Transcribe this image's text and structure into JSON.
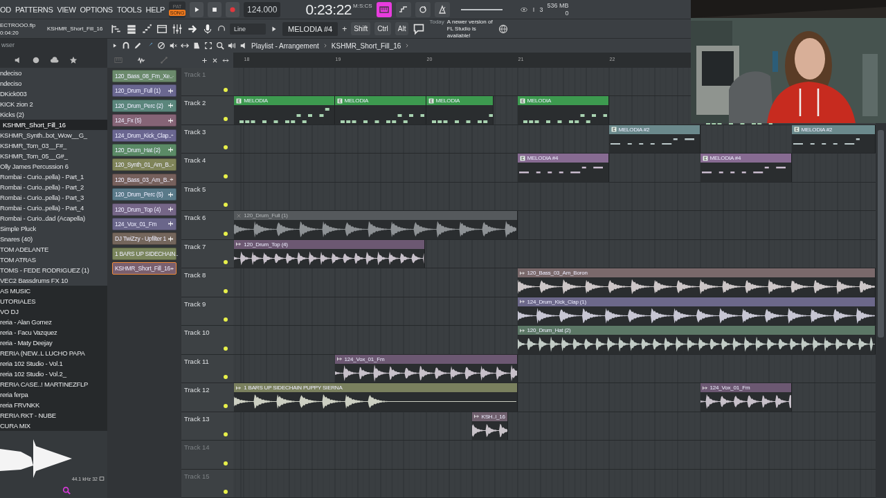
{
  "menu": [
    "OD",
    "PATTERNS",
    "VIEW",
    "OPTIONS",
    "TOOLS",
    "HELP"
  ],
  "modes": [
    {
      "label": "PAT",
      "selected": false
    },
    {
      "label": "SONG",
      "selected": true
    }
  ],
  "tempo": "124.000",
  "time": {
    "value": "0:23:22",
    "unit": "M:S:CS"
  },
  "monitor": {
    "cpu": "3",
    "memory": "536 MB",
    "polyphony": "0"
  },
  "project": {
    "file": "ECTROOO.flp",
    "duration": "0:04:20",
    "sample": "KSHMR_Short_Fill_16"
  },
  "recording_input": "Line",
  "pattern": {
    "name": "MELODIA #4",
    "add": "+"
  },
  "modifiers": [
    "Shift",
    "Ctrl",
    "Alt"
  ],
  "hint": {
    "date": "Today",
    "message": "A newer version of FL Studio is available!"
  },
  "browser": {
    "title": "wser",
    "items": [
      {
        "label": "ndeciso",
        "kind": "file",
        "selected": false
      },
      {
        "label": "ndeciso",
        "kind": "file",
        "selected": false
      },
      {
        "label": "DKick003",
        "kind": "file",
        "selected": false
      },
      {
        "label": "KICK zion 2",
        "kind": "file",
        "selected": false
      },
      {
        "label": "Kicks (2)",
        "kind": "file",
        "selected": false
      },
      {
        "label": "KSHMR_Short_Fill_16",
        "kind": "file",
        "selected": true
      },
      {
        "label": "KSHMR_Synth..bot_Wow__G_",
        "kind": "file",
        "selected": false
      },
      {
        "label": "KSHMR_Tom_03__F#_",
        "kind": "file",
        "selected": false
      },
      {
        "label": "KSHMR_Tom_05__G#_",
        "kind": "file",
        "selected": false
      },
      {
        "label": "Olly James Percussion 6",
        "kind": "file",
        "selected": false
      },
      {
        "label": "Rombai - Curio..pella) - Part_1",
        "kind": "file",
        "selected": false
      },
      {
        "label": "Rombai - Curio..pella) - Part_2",
        "kind": "file",
        "selected": false
      },
      {
        "label": "Rombai - Curio..pella) - Part_3",
        "kind": "file",
        "selected": false
      },
      {
        "label": "Rombai - Curio..pella) - Part_4",
        "kind": "file",
        "selected": false
      },
      {
        "label": "Rombai - Curio..dad (Acapella)",
        "kind": "file",
        "selected": false
      },
      {
        "label": "Simple Pluck",
        "kind": "file",
        "selected": false
      },
      {
        "label": "Snares (40)",
        "kind": "file",
        "selected": false
      },
      {
        "label": "TOM ADELANTE",
        "kind": "file",
        "selected": false
      },
      {
        "label": "TOM ATRAS",
        "kind": "file",
        "selected": false
      },
      {
        "label": "TOMS - FEDE RODRIGUEZ (1)",
        "kind": "file",
        "selected": false
      },
      {
        "label": "VEC2 Bassdrums FX 10",
        "kind": "file",
        "selected": false
      },
      {
        "label": "AS MUSIC",
        "kind": "folder",
        "selected": false
      },
      {
        "label": "UTORIALES",
        "kind": "folder",
        "selected": false
      },
      {
        "label": "VO DJ",
        "kind": "folder",
        "selected": false
      },
      {
        "label": "reria - Alan Gomez",
        "kind": "folder",
        "selected": false
      },
      {
        "label": "reria - Facu Vazquez",
        "kind": "folder",
        "selected": false
      },
      {
        "label": "reria - Maty Deejay",
        "kind": "folder",
        "selected": false
      },
      {
        "label": "RERIA (NEW..L LUCHO PAPA",
        "kind": "folder",
        "selected": false
      },
      {
        "label": "reria 102 Studio - Vol.1",
        "kind": "folder",
        "selected": false
      },
      {
        "label": "reria 102 Studio - Vol.2_",
        "kind": "folder",
        "selected": false
      },
      {
        "label": "RERIA CASE..! MARTINEZFLP",
        "kind": "folder",
        "selected": false
      },
      {
        "label": "reria ferpa",
        "kind": "folder",
        "selected": false
      },
      {
        "label": "reria FRVNKK",
        "kind": "folder",
        "selected": false
      },
      {
        "label": "RERIA RKT - NUBE",
        "kind": "folder",
        "selected": false
      },
      {
        "label": "CURA MIX",
        "kind": "folder",
        "selected": false
      }
    ],
    "preview_info": "44.1 kHz 32"
  },
  "channels": [
    {
      "label": "120_Bass_08_Fm_Xe..",
      "color": "#6b8a6c",
      "selected": false
    },
    {
      "label": "120_Drum_Full (1)",
      "color": "#6a6790",
      "selected": false
    },
    {
      "label": "120_Drum_Perc (2)",
      "color": "#5b867c",
      "selected": false
    },
    {
      "label": "124_Fx (5)",
      "color": "#856476",
      "selected": false
    },
    {
      "label": "124_Drum_Kick_Clap..",
      "color": "#6a6690",
      "selected": false
    },
    {
      "label": "120_Drum_Hat (2)",
      "color": "#5b8a66",
      "selected": false
    },
    {
      "label": "120_Synth_01_Am_B..",
      "color": "#7f8459",
      "selected": false
    },
    {
      "label": "120_Bass_03_Am_B..",
      "color": "#76605c",
      "selected": false
    },
    {
      "label": "120_Drum_Perc (5)",
      "color": "#5a7a89",
      "selected": false
    },
    {
      "label": "120_Drum_Top (4)",
      "color": "#756687",
      "selected": false
    },
    {
      "label": "124_Vox_01_Fm",
      "color": "#6a668a",
      "selected": false
    },
    {
      "label": "DJ TwiZzy - Upfilter 1",
      "color": "#74665c",
      "selected": false
    },
    {
      "label": "1 BARS UP SIDECHAIN..",
      "color": "#7a855c",
      "selected": false
    },
    {
      "label": "KSHMR_Short_Fill_16",
      "color": "#7a5f6e",
      "selected": true
    }
  ],
  "playlist": {
    "title": "Playlist - Arrangement",
    "pattern": "KSHMR_Short_Fill_16",
    "ruler": [
      "18",
      "19",
      "20",
      "21",
      "22"
    ],
    "tracks": [
      {
        "name": "Track 1",
        "dimmed": true
      },
      {
        "name": "Track 2",
        "dimmed": false,
        "clips": [
          {
            "label": "MELODIA",
            "kind": "pattern",
            "color": "#3d9a4f",
            "muted": false
          },
          {
            "label": "MELODIA",
            "kind": "pattern",
            "color": "#3d9a4f",
            "muted": false
          },
          {
            "label": "MELODIA",
            "kind": "pattern",
            "color": "#3d9a4f",
            "muted": false
          },
          {
            "label": "MELODIA",
            "kind": "pattern",
            "color": "#3d9a4f",
            "muted": false
          },
          {
            "kind": "pattern"
          }
        ]
      },
      {
        "name": "Track 3",
        "dimmed": false,
        "clips": [
          {
            "label": "MELODIA #2",
            "kind": "pattern",
            "color": "#6b898c",
            "muted": false
          },
          {
            "label": "MELODIA #2",
            "kind": "pattern",
            "color": "#6b898c",
            "muted": false
          }
        ]
      },
      {
        "name": "Track 4",
        "dimmed": false,
        "clips": [
          {
            "label": "MELODIA #4",
            "kind": "pattern",
            "color": "#876b92",
            "muted": false
          },
          {
            "label": "MELODIA #4",
            "kind": "pattern",
            "color": "#876b92",
            "muted": false
          }
        ]
      },
      {
        "name": "Track 5",
        "dimmed": false
      },
      {
        "name": "Track 6",
        "dimmed": false,
        "clips": [
          {
            "label": "120_Drum_Full (1)",
            "kind": "audio",
            "color": "#55595c",
            "muted": true
          }
        ]
      },
      {
        "name": "Track 7",
        "dimmed": false,
        "clips": [
          {
            "label": "120_Drum_Top (4)",
            "kind": "audio",
            "color": "#6c5872",
            "muted": false
          }
        ]
      },
      {
        "name": "Track 8",
        "dimmed": false,
        "clips": [
          {
            "label": "120_Bass_03_Am_Boron",
            "kind": "audio",
            "color": "#7a696b",
            "muted": false
          }
        ]
      },
      {
        "name": "Track 9",
        "dimmed": false,
        "clips": [
          {
            "label": "124_Drum_Kick_Clap (1)",
            "kind": "audio",
            "color": "#6c688a",
            "muted": false
          }
        ]
      },
      {
        "name": "Track 10",
        "dimmed": false,
        "clips": [
          {
            "label": "120_Drum_Hat (2)",
            "kind": "audio",
            "color": "#5c7766",
            "muted": false
          }
        ]
      },
      {
        "name": "Track 11",
        "dimmed": false,
        "clips": [
          {
            "label": "124_Vox_01_Fm",
            "kind": "audio",
            "color": "#6c5872",
            "muted": false
          }
        ]
      },
      {
        "name": "Track 12",
        "dimmed": false,
        "clips": [
          {
            "label": "1 BARS UP SIDECHAIN PUPPY SIERNA",
            "kind": "audio",
            "color": "#7a805e",
            "muted": false
          },
          {
            "label": "124_Vox_01_Fm",
            "kind": "audio",
            "color": "#6c5872",
            "muted": false
          }
        ]
      },
      {
        "name": "Track 13",
        "dimmed": false,
        "clips": [
          {
            "label": "KSH..l_16",
            "kind": "audio",
            "color": "#6f5f6d",
            "muted": false
          }
        ]
      },
      {
        "name": "Track 14",
        "dimmed": true
      },
      {
        "name": "Track 15",
        "dimmed": true
      }
    ]
  }
}
